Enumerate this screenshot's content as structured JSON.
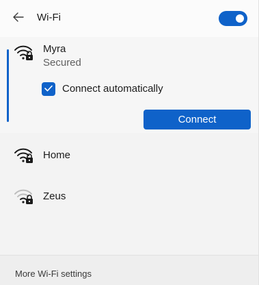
{
  "header": {
    "back_icon": "back-arrow-icon",
    "title": "Wi-Fi",
    "toggle_state": "on"
  },
  "colors": {
    "accent": "#0f62c9",
    "panel": "#f3f3f3",
    "text": "#1b1b1b",
    "secondary_text": "#5f5f5f",
    "wifi_dim": "#bdbdbd"
  },
  "networks": [
    {
      "name": "Myra",
      "status": "Secured",
      "icon": "wifi-secured-icon",
      "selected": true,
      "auto_connect_label": "Connect automatically",
      "auto_connect_checked": true,
      "connect_label": "Connect"
    },
    {
      "name": "Home",
      "icon": "wifi-secured-icon"
    },
    {
      "name": "Zeus",
      "icon": "wifi-secured-weak-icon"
    }
  ],
  "footer": {
    "link_label": "More Wi-Fi settings"
  }
}
